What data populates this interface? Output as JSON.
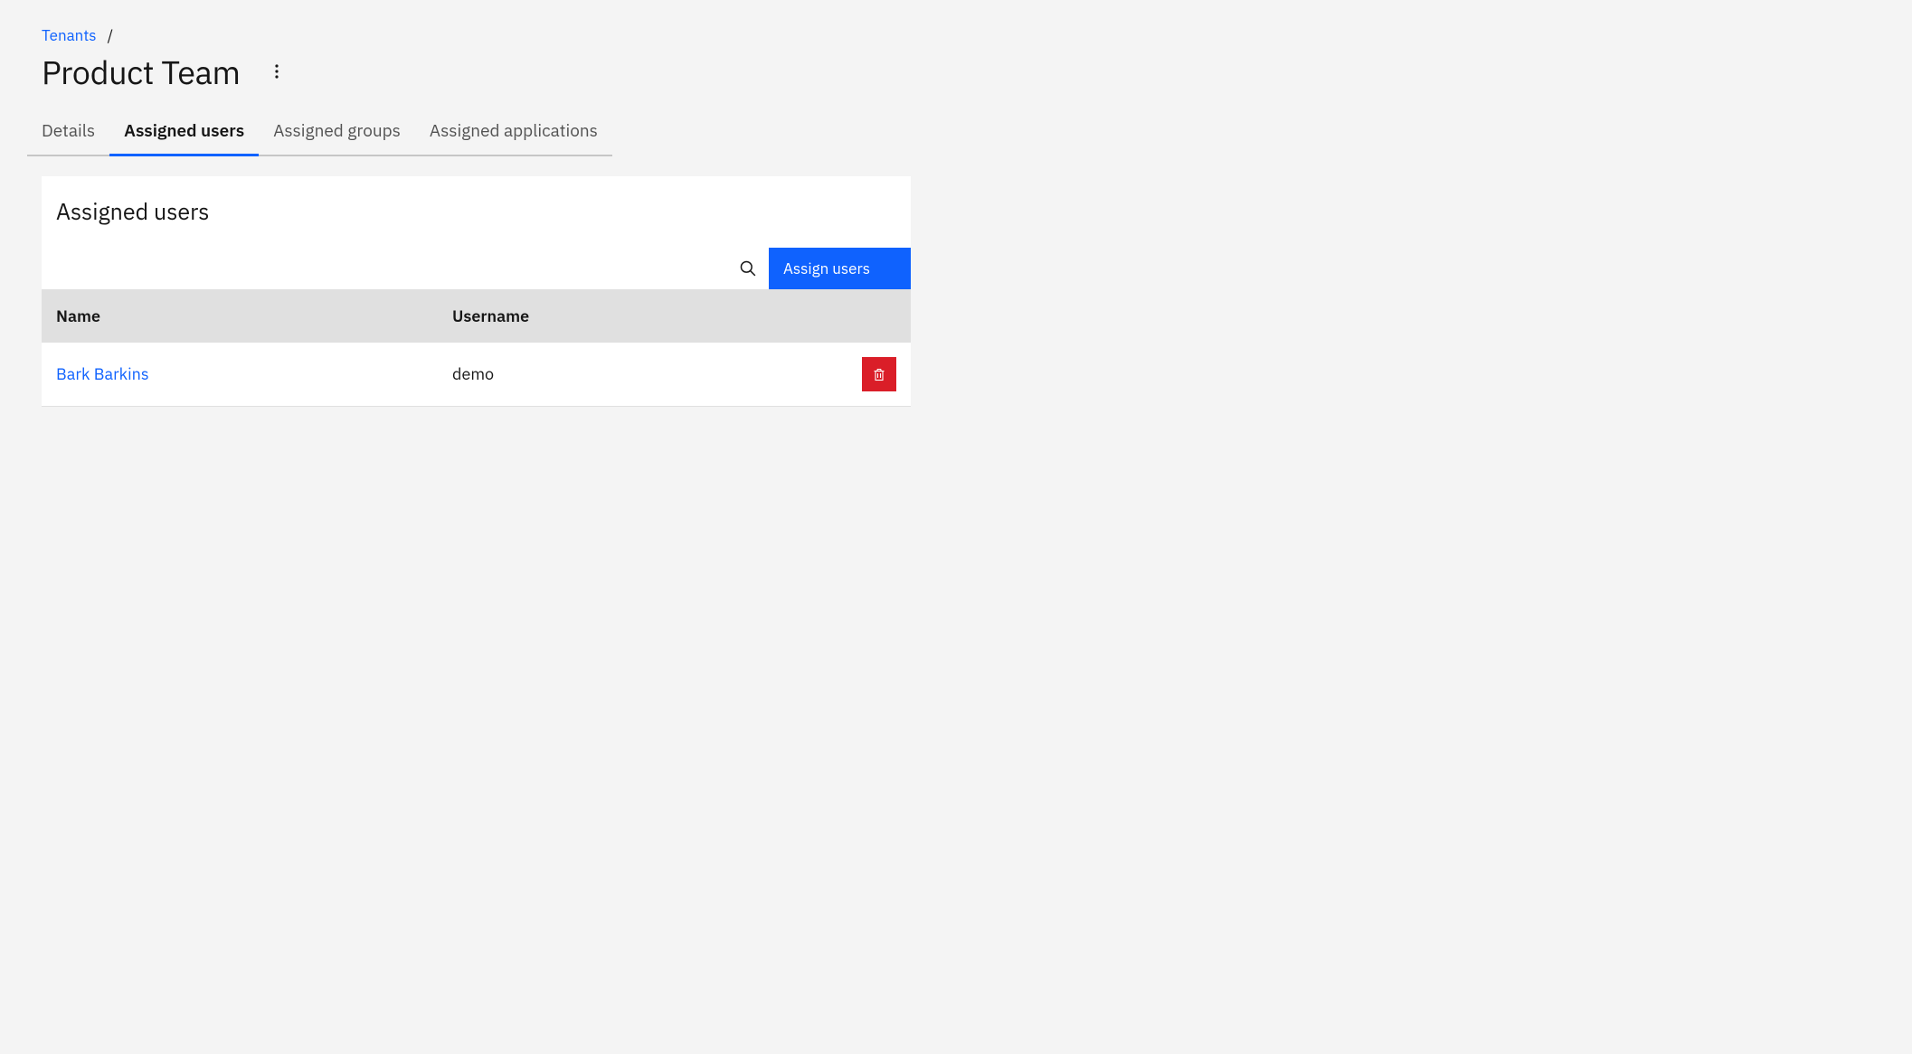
{
  "breadcrumb": {
    "parent": "Tenants",
    "separator": "/"
  },
  "header": {
    "title": "Product Team"
  },
  "tabs": [
    {
      "label": "Details",
      "active": false
    },
    {
      "label": "Assigned users",
      "active": true
    },
    {
      "label": "Assigned groups",
      "active": false
    },
    {
      "label": "Assigned applications",
      "active": false
    }
  ],
  "panel": {
    "title": "Assigned users",
    "assign_btn_label": "Assign users",
    "table": {
      "columns": {
        "name": "Name",
        "username": "Username"
      },
      "rows": [
        {
          "name": "Bark Barkins",
          "username": "demo"
        }
      ]
    }
  },
  "colors": {
    "primary": "#0f62fe",
    "danger": "#da1e28"
  }
}
